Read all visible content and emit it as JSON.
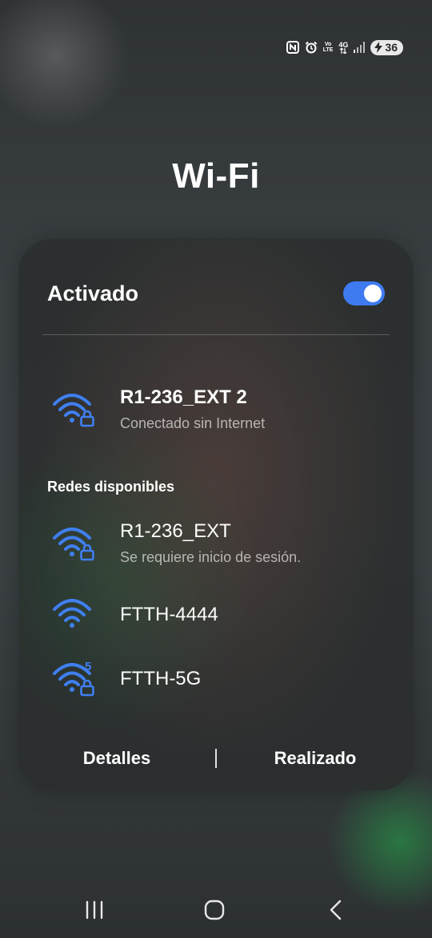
{
  "status_bar": {
    "icons": [
      "nfc-icon",
      "alarm-icon",
      "volte-icon",
      "4g-icon",
      "signal-icon",
      "battery-icon"
    ],
    "volte_top": "Vo",
    "volte_bottom": "LTE",
    "network_type": "4G",
    "battery_level": "36",
    "battery_charging": true
  },
  "header": {
    "title": "Wi-Fi"
  },
  "wifi_panel": {
    "toggle": {
      "label": "Activado",
      "enabled": true
    },
    "connected_network": {
      "name": "R1-236_EXT 2",
      "status": "Conectado sin Internet",
      "secured": true,
      "icon": "wifi-lock-icon"
    },
    "available_label": "Redes disponibles",
    "available_networks": [
      {
        "name": "R1-236_EXT",
        "status": "Se requiere inicio de sesión.",
        "secured": true,
        "icon": "wifi-lock-icon"
      },
      {
        "name": "FTTH-4444",
        "secured": false,
        "icon": "wifi-icon"
      },
      {
        "name": "FTTH-5G",
        "secured": true,
        "band": "5",
        "icon": "wifi-5g-lock-icon"
      }
    ],
    "buttons": {
      "details": "Detalles",
      "done": "Realizado"
    }
  },
  "navigation_bar": {
    "icons": [
      "recent-apps-icon",
      "home-icon",
      "back-icon"
    ]
  },
  "colors": {
    "accent": "#3e7bf1",
    "wifi_icon": "#3f7ff0",
    "text_primary": "#ffffff"
  }
}
